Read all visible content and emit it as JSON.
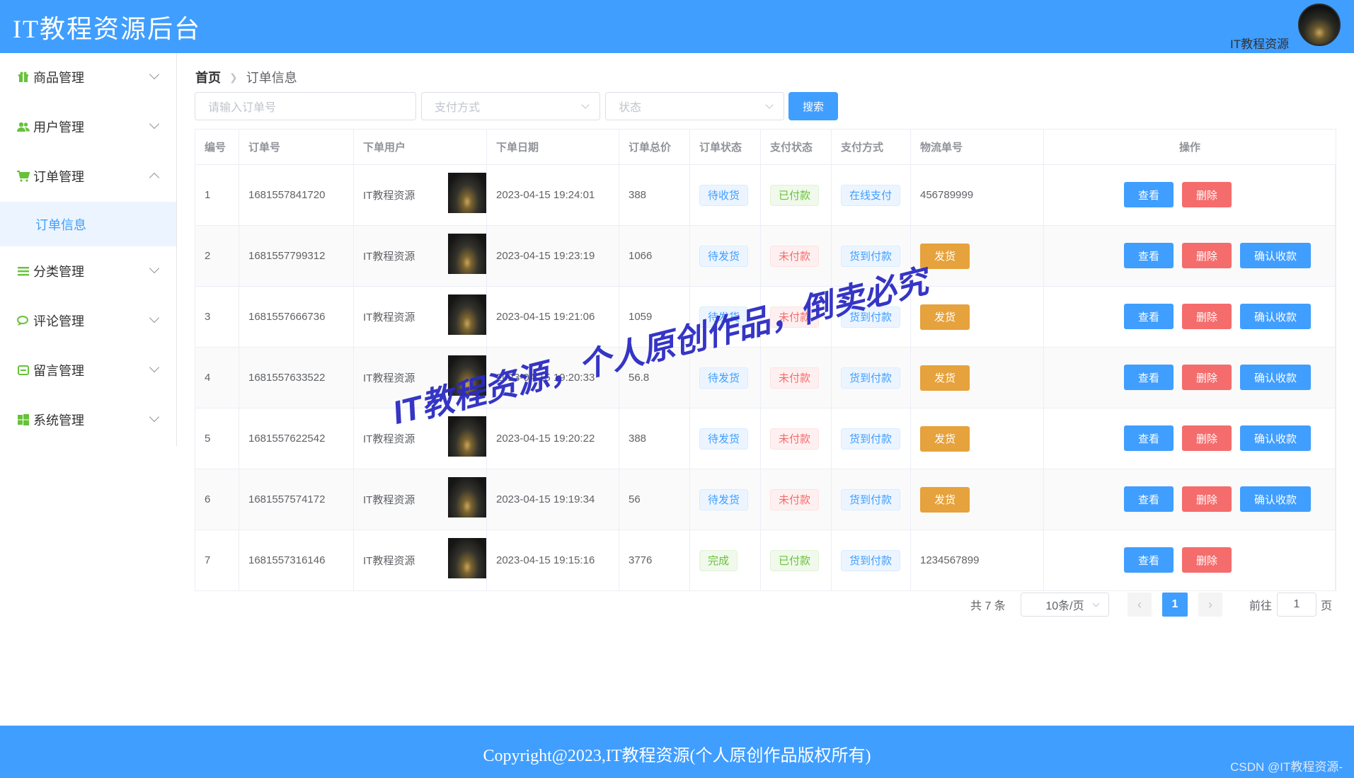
{
  "header": {
    "title": "IT教程资源后台",
    "user_name": "IT教程资源"
  },
  "sidebar": {
    "items": [
      {
        "label": "商品管理",
        "icon": "gift-icon",
        "icon_color": "#67c23a"
      },
      {
        "label": "用户管理",
        "icon": "users-icon",
        "icon_color": "#67c23a"
      },
      {
        "label": "订单管理",
        "icon": "cart-icon",
        "icon_color": "#67c23a"
      },
      {
        "label": "分类管理",
        "icon": "list-icon",
        "icon_color": "#67c23a"
      },
      {
        "label": "评论管理",
        "icon": "comment-icon",
        "icon_color": "#67c23a"
      },
      {
        "label": "留言管理",
        "icon": "message-icon",
        "icon_color": "#67c23a"
      },
      {
        "label": "系统管理",
        "icon": "windows-icon",
        "icon_color": "#67c23a"
      }
    ],
    "submenu_active": "订单信息"
  },
  "breadcrumb": {
    "home": "首页",
    "current": "订单信息"
  },
  "search": {
    "order_placeholder": "请输入订单号",
    "pay_method_placeholder": "支付方式",
    "status_placeholder": "状态",
    "button": "搜索"
  },
  "table": {
    "headers": [
      "编号",
      "订单号",
      "下单用户",
      "下单日期",
      "订单总价",
      "订单状态",
      "支付状态",
      "支付方式",
      "物流单号",
      "操作"
    ],
    "rows": [
      {
        "id": "1",
        "order_no": "1681557841720",
        "user": "IT教程资源",
        "date": "2023-04-15 19:24:01",
        "total": "388",
        "order_status": "待收货",
        "pay_status": "已付款",
        "pay_method": "在线支付",
        "logistics": "456789999",
        "ship": "",
        "confirm": ""
      },
      {
        "id": "2",
        "order_no": "1681557799312",
        "user": "IT教程资源",
        "date": "2023-04-15 19:23:19",
        "total": "1066",
        "order_status": "待发货",
        "pay_status": "未付款",
        "pay_method": "货到付款",
        "logistics": "",
        "ship": "发货",
        "confirm": "确认收款"
      },
      {
        "id": "3",
        "order_no": "1681557666736",
        "user": "IT教程资源",
        "date": "2023-04-15 19:21:06",
        "total": "1059",
        "order_status": "待发货",
        "pay_status": "未付款",
        "pay_method": "货到付款",
        "logistics": "",
        "ship": "发货",
        "confirm": "确认收款"
      },
      {
        "id": "4",
        "order_no": "1681557633522",
        "user": "IT教程资源",
        "date": "2023-04-15 19:20:33",
        "total": "56.8",
        "order_status": "待发货",
        "pay_status": "未付款",
        "pay_method": "货到付款",
        "logistics": "",
        "ship": "发货",
        "confirm": "确认收款"
      },
      {
        "id": "5",
        "order_no": "1681557622542",
        "user": "IT教程资源",
        "date": "2023-04-15 19:20:22",
        "total": "388",
        "order_status": "待发货",
        "pay_status": "未付款",
        "pay_method": "货到付款",
        "logistics": "",
        "ship": "发货",
        "confirm": "确认收款"
      },
      {
        "id": "6",
        "order_no": "1681557574172",
        "user": "IT教程资源",
        "date": "2023-04-15 19:19:34",
        "total": "56",
        "order_status": "待发货",
        "pay_status": "未付款",
        "pay_method": "货到付款",
        "logistics": "",
        "ship": "发货",
        "confirm": "确认收款"
      },
      {
        "id": "7",
        "order_no": "1681557316146",
        "user": "IT教程资源",
        "date": "2023-04-15 19:15:16",
        "total": "3776",
        "order_status": "完成",
        "pay_status": "已付款",
        "pay_method": "货到付款",
        "logistics": "1234567899",
        "ship": "",
        "confirm": ""
      }
    ],
    "view_label": "查看",
    "delete_label": "删除"
  },
  "pagination": {
    "total_text": "共 7 条",
    "page_size": "10条/页",
    "current_page": "1",
    "goto_prefix": "前往",
    "goto_value": "1",
    "goto_suffix": "页"
  },
  "watermark": "IT教程资源，个人原创作品，倒卖必究",
  "footer": {
    "copyright": "Copyright@2023,IT教程资源(个人原创作品版权所有)",
    "csdn": "CSDN @IT教程资源-"
  },
  "colors": {
    "primary": "#409eff",
    "danger": "#f56c6c",
    "warning": "#e6a23c",
    "success": "#67c23a"
  }
}
